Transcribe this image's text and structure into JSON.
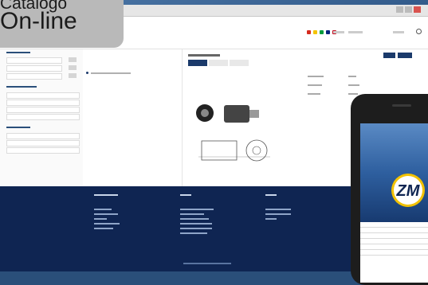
{
  "badge": {
    "line1": "Catalogo",
    "line2": "On-line"
  },
  "brand_colors": {
    "navy": "#0f2552",
    "accent_blue": "#1b3a6b",
    "badge_grey": "#b9b9b9"
  },
  "phone": {
    "logo_text": "ZM"
  }
}
